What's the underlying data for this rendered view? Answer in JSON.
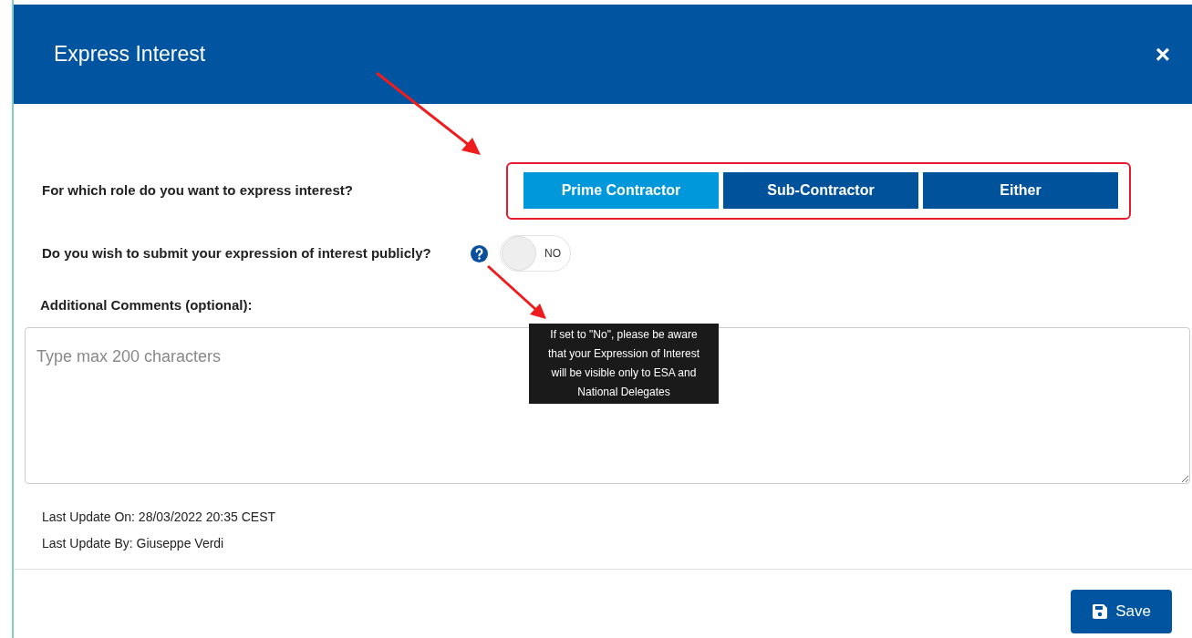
{
  "dialog": {
    "title": "Express Interest",
    "close": "×"
  },
  "role_question": {
    "label": "For which role do you want to express interest?",
    "options": [
      {
        "label": "Prime Contractor",
        "selected": true
      },
      {
        "label": "Sub-Contractor",
        "selected": false
      },
      {
        "label": "Either",
        "selected": false
      }
    ]
  },
  "public_question": {
    "label": "Do you wish to submit your expression of interest publicly?",
    "help_tooltip": "If set to \"No\", please be aware that your Expression of Interest will be visible only to ESA and National Delegates",
    "toggle": {
      "on": false,
      "label": "NO"
    }
  },
  "comments": {
    "label": "Additional Comments (optional):",
    "placeholder": "Type max 200 characters"
  },
  "last_update_on": "Last Update On: 28/03/2022 20:35 CEST",
  "last_update_by": "Last Update By: Giuseppe Verdi",
  "save_button": "Save"
}
